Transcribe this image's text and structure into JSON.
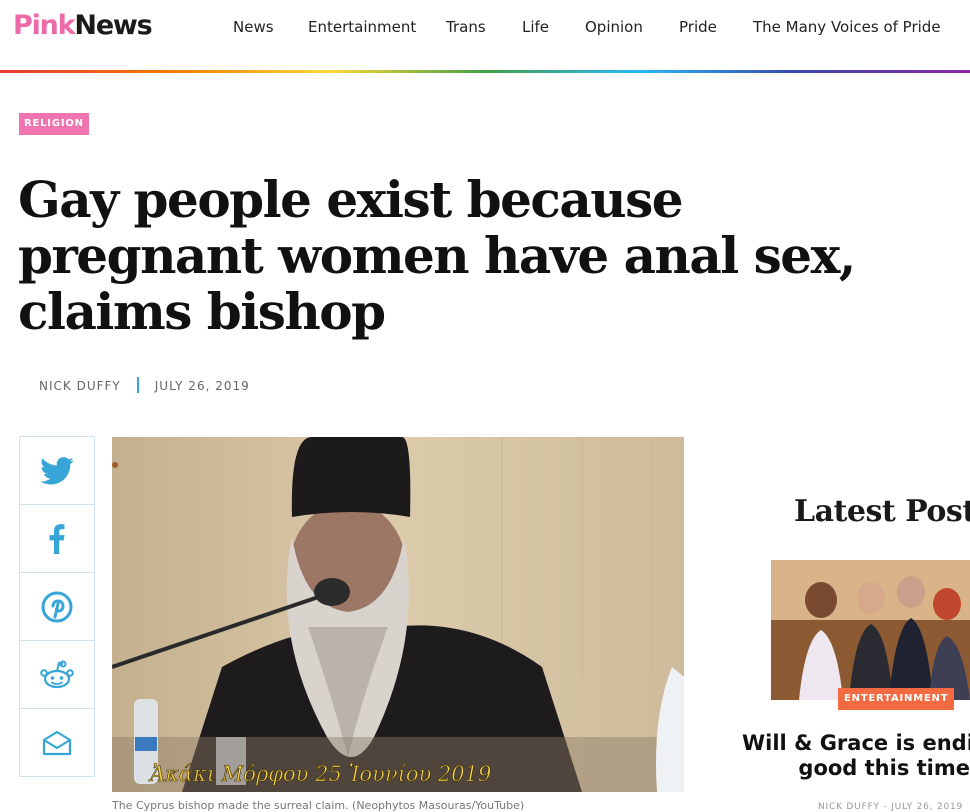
{
  "logo": {
    "pink": "Pink",
    "dark": "News"
  },
  "nav": [
    "News",
    "Entertainment",
    "Trans",
    "Life",
    "Opinion",
    "Pride",
    "The Many Voices of Pride"
  ],
  "article": {
    "category": "RELIGION",
    "headline_lines": [
      "Gay people exist because",
      "pregnant women have anal sex,",
      "claims bishop"
    ],
    "author": "NICK DUFFY",
    "date": "JULY 26, 2019",
    "image_overlay_text": "Ἀκάκι Μόρφου  25 Ἰουνίου 2019",
    "caption": "The Cyprus bishop made the surreal claim. (Neophytos Masouras/YouTube)"
  },
  "share_icons": [
    "twitter-icon",
    "facebook-icon",
    "pinterest-icon",
    "reddit-icon",
    "email-icon"
  ],
  "sidebar": {
    "title": "Latest Post",
    "post": {
      "category": "ENTERTAINMENT",
      "title_lines": [
        "Will & Grace is endi",
        "good this time"
      ],
      "author": "NICK DUFFY",
      "date": "JULY 26, 2019"
    }
  },
  "colors": {
    "brand_pink": "#ef74b0",
    "share_blue": "#38a5d8",
    "entertainment_orange": "#f26a41"
  }
}
